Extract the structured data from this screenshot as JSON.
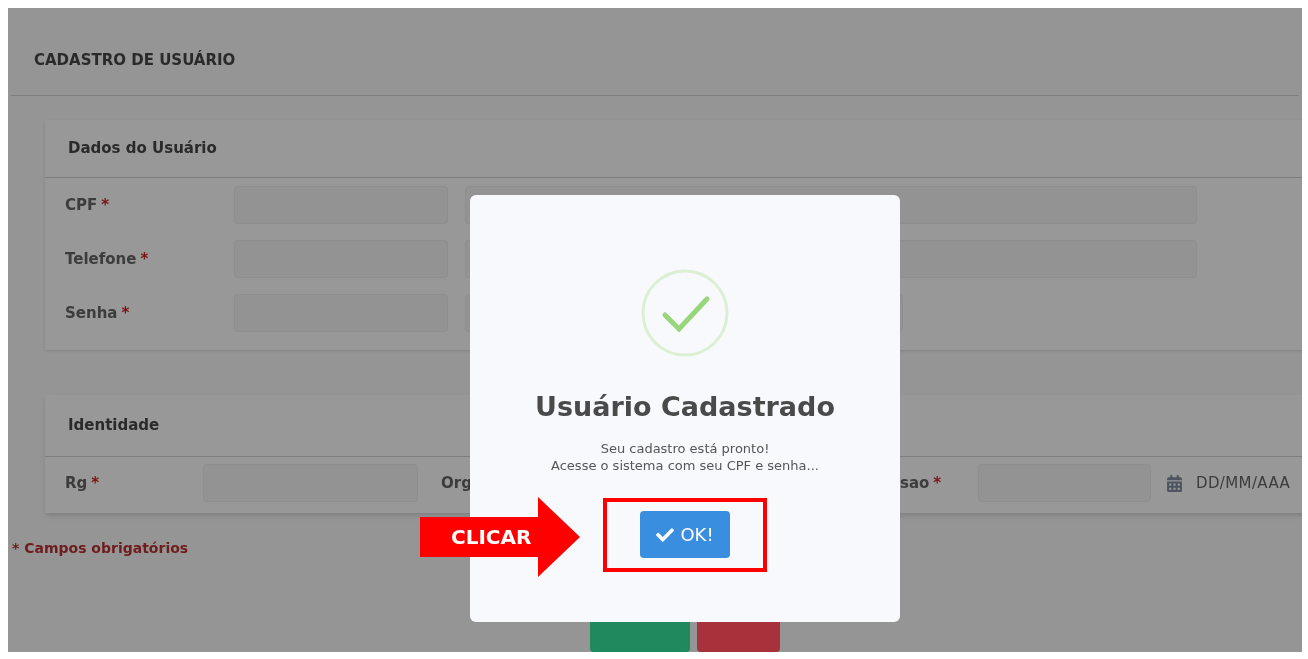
{
  "header": {
    "title": "CADASTRO DE USUÁRIO"
  },
  "user_section": {
    "title": "Dados do Usuário",
    "rows": [
      {
        "label": "CPF",
        "mark": "*",
        "wide": true
      },
      {
        "label": "Telefone",
        "mark": "*",
        "wide": true
      },
      {
        "label": "Senha",
        "mark": "*",
        "wide": false
      }
    ]
  },
  "identity_section": {
    "title": "Identidade",
    "fields": [
      {
        "label": "Rg",
        "mark": "*"
      },
      {
        "label": "Org"
      },
      {
        "label": "sao",
        "mark": "*"
      }
    ],
    "date_field": {
      "placeholder": "DD/MM/AAA"
    }
  },
  "footnote": "* Campos obrigatórios",
  "modal": {
    "title": "Usuário Cadastrado",
    "message": [
      "Seu cadastro está pronto!",
      "Acesse o sistema com seu CPF e senha..."
    ],
    "button": "OK!"
  },
  "annotation": {
    "label": "CLICAR"
  }
}
